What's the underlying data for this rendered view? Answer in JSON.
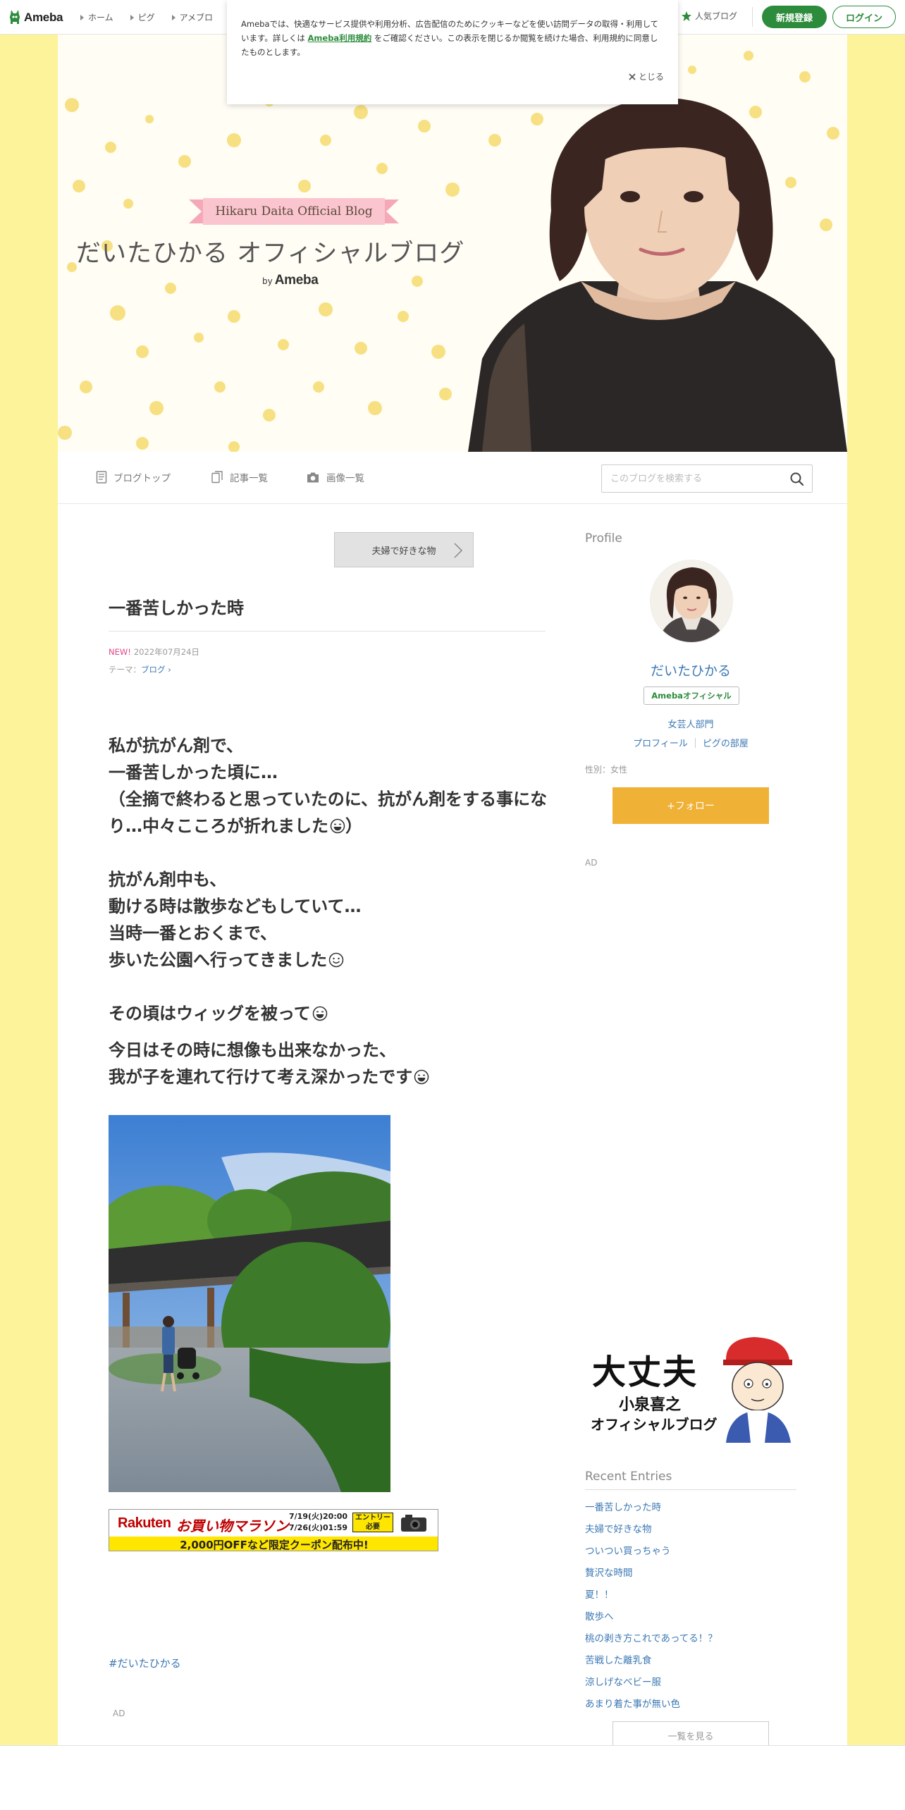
{
  "topbar": {
    "logo_text": "Ameba",
    "nav": [
      "ホーム",
      "ピグ",
      "アメブロ"
    ],
    "popular_label": "人気ブログ",
    "register_label": "新規登録",
    "login_label": "ログイン"
  },
  "cookie": {
    "text_before": "Amebaでは、快適なサービス提供や利用分析、広告配信のためにクッキーなどを使い訪問データの取得・利用しています。詳しくは",
    "link": "Ameba利用規約",
    "text_after": "をご確認ください。この表示を閉じるか閲覧を続けた場合、利用規約に同意したものとします。",
    "close_label": "とじる"
  },
  "banner": {
    "ribbon": "Hikaru Daita Official Blog",
    "title": "だいたひかる オフィシャルブログ",
    "by": "by",
    "brand": "Ameba"
  },
  "blognav": {
    "items": [
      "ブログトップ",
      "記事一覧",
      "画像一覧"
    ],
    "search_placeholder": "このブログを検索する"
  },
  "article": {
    "prev_label": "夫婦で好きな物",
    "title": "一番苦しかった時",
    "new_label": "NEW!",
    "date": "2022年07月24日",
    "theme_prefix": "テーマ：",
    "theme": "ブログ",
    "lines": {
      "l1": "私が抗がん剤で、",
      "l2": "一番苦しかった頃に…",
      "l3": "（全摘で終わると思っていたのに、抗がん剤をする事になり…中々こころが折れました",
      "l3_end": "）",
      "l4": "抗がん剤中も、",
      "l5": "動ける時は散歩などもしていて…",
      "l6": "当時一番とおくまで、",
      "l7": "歩いた公園へ行ってきました",
      "l8": "その頃はウィッグを被って",
      "l9": "今日はその時に想像も出来なかった、",
      "l10": "我が子を連れて行けて考え深かったです"
    },
    "hashtag": "#だいたひかる",
    "ad_label": "AD"
  },
  "rakuten_ad": {
    "logo": "Rakuten",
    "campaign": "お買い物マラソン",
    "date1": "7/19(火)20:00",
    "date2": "7/26(火)01:59",
    "entry1": "エントリー",
    "entry2": "必要",
    "bottom": "2,000円OFFなど限定クーポン配布中!"
  },
  "sidebar": {
    "profile_heading": "Profile",
    "name": "だいたひかる",
    "badge": "Amebaオフィシャル",
    "category": "女芸人部門",
    "link_profile": "プロフィール",
    "link_pig": "ピグの部屋",
    "gender": "性別：女性",
    "follow_label": "+フォロー",
    "ad_label": "AD",
    "recent_heading": "Recent Entries",
    "recent": [
      "一番苦しかった時",
      "夫婦で好きな物",
      "ついつい買っちゃう",
      "贅沢な時間",
      "夏！！",
      "散歩へ",
      "桃の剥き方これであってる！？",
      "苦戦した離乳食",
      "涼しげなベビー服",
      "あまり着た事が無い色"
    ],
    "see_all": "一覧を見る",
    "daijobu": {
      "big": "大丈夫",
      "name": "小泉喜之",
      "sub": "オフィシャルブログ"
    }
  },
  "colors": {
    "brand_green": "#2d8c3c",
    "link_blue": "#3c78b4",
    "follow_orange": "#efb136",
    "page_yellow": "#fdf39a"
  }
}
